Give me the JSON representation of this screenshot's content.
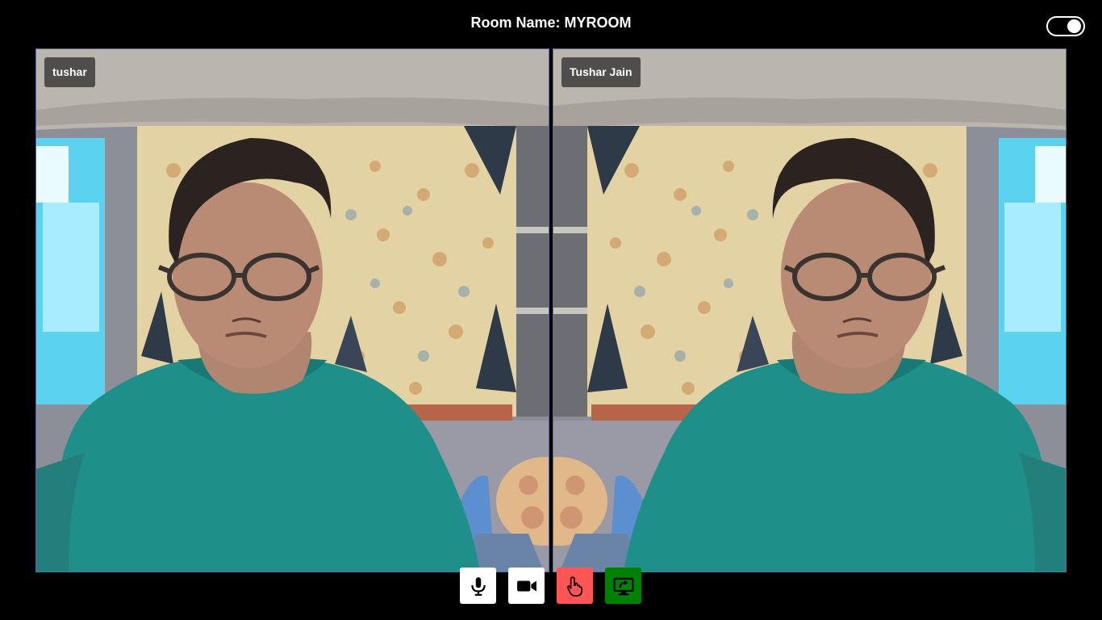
{
  "header": {
    "room_title": "Room Name: MYROOM"
  },
  "theme_toggle": {
    "state": "on"
  },
  "participants": [
    {
      "name": "tushar"
    },
    {
      "name": "Tushar Jain"
    }
  ],
  "controls": [
    {
      "name": "microphone",
      "icon": "microphone-icon",
      "bg": "#ffffff",
      "fg": "#000000"
    },
    {
      "name": "camera",
      "icon": "video-camera-icon",
      "bg": "#ffffff",
      "fg": "#000000"
    },
    {
      "name": "raise-hand",
      "icon": "hand-pointer-icon",
      "bg": "#ff5555",
      "fg": "#000000"
    },
    {
      "name": "share-screen",
      "icon": "screen-share-icon",
      "bg": "#008000",
      "fg": "#000000"
    }
  ],
  "colors": {
    "background": "#000000",
    "tile_border": "#5f6a9a",
    "shirt": "#1f8f8a",
    "curtain": "#e6d7a8"
  }
}
